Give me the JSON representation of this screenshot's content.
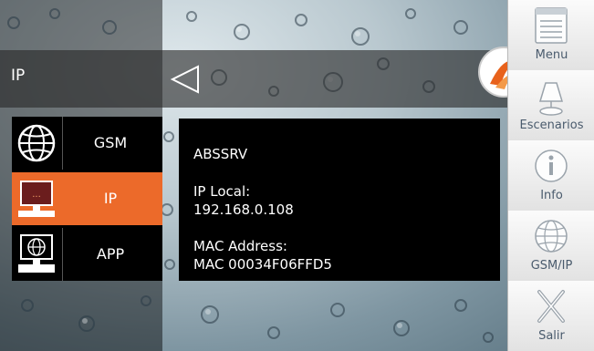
{
  "header": {
    "title": "IP"
  },
  "menu": {
    "items": [
      {
        "label": "GSM",
        "icon": "globe-icon",
        "active": false
      },
      {
        "label": "IP",
        "icon": "computer-icon",
        "active": true
      },
      {
        "label": "APP",
        "icon": "computer-globe-icon",
        "active": false
      }
    ]
  },
  "info": {
    "device_name": "ABSSRV",
    "ip_label": "IP Local:",
    "ip_value": "192.168.0.108",
    "mac_label": "MAC Address:",
    "mac_value": "MAC 00034F06FFD5"
  },
  "sidebar": {
    "items": [
      {
        "label": "Menu",
        "icon": "menu-list-icon"
      },
      {
        "label": "Escenarios",
        "icon": "lamp-icon"
      },
      {
        "label": "Info",
        "icon": "info-icon"
      },
      {
        "label": "GSM/IP",
        "icon": "globe-icon"
      },
      {
        "label": "Salir",
        "icon": "close-icon"
      }
    ]
  },
  "colors": {
    "accent": "#ec6a2a",
    "panel": "#000000",
    "sidebar_text": "#4a5b6d"
  }
}
